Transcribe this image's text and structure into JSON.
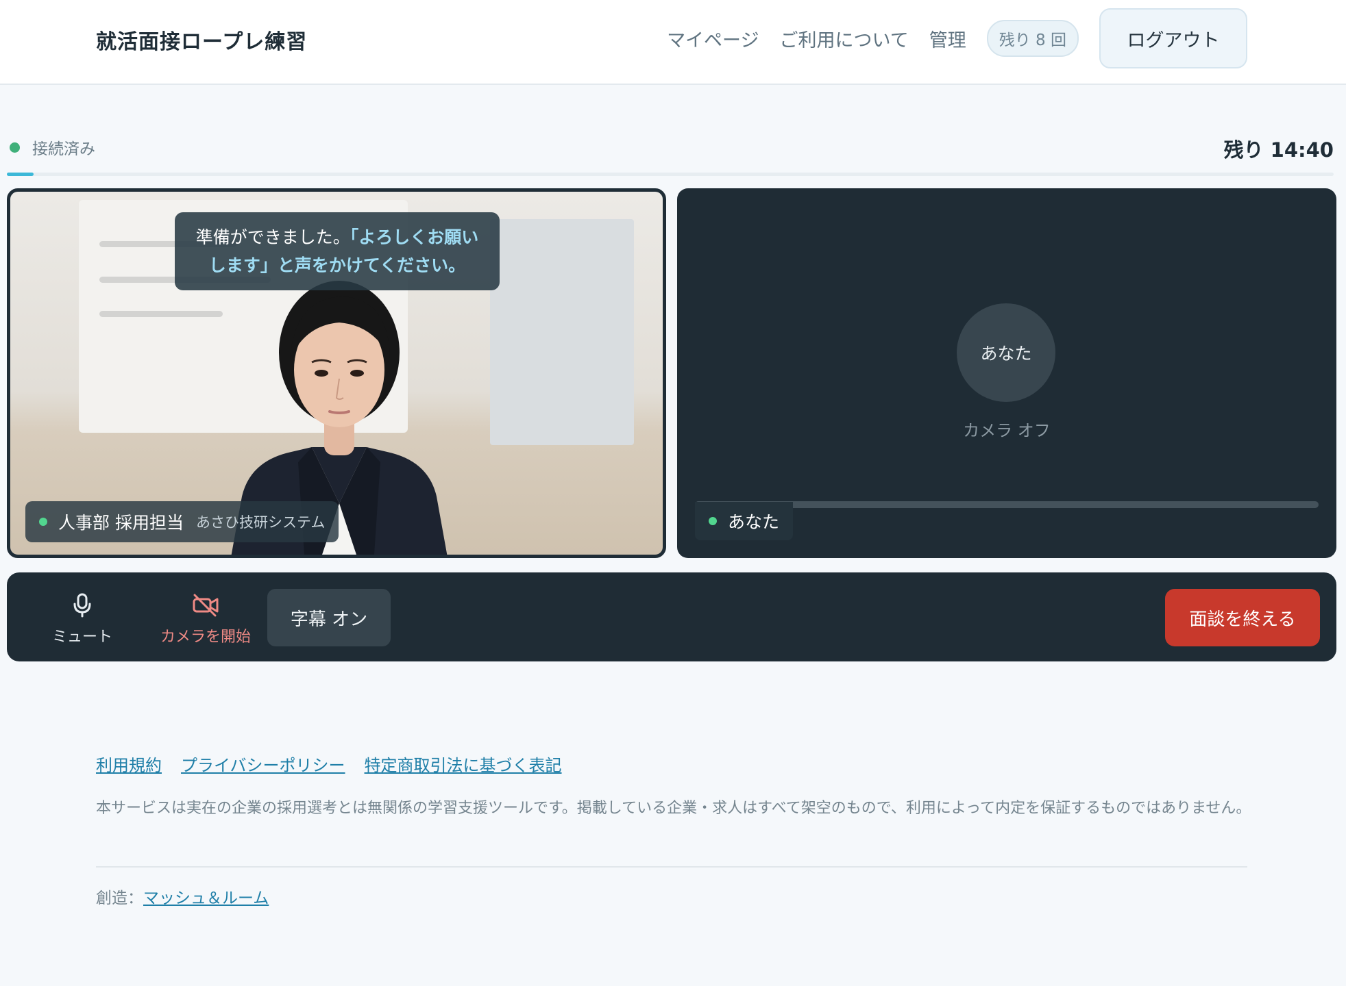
{
  "header": {
    "brand": "就活面接ロープレ練習",
    "nav": {
      "mypage": "マイページ",
      "about": "ご利用について",
      "admin": "管理"
    },
    "remaining_badge": "残り 8 回",
    "logout_label": "ログアウト"
  },
  "session": {
    "status": "接続済み",
    "status_color": "#3fb07a",
    "timer": "残り 14:40",
    "progress_fraction": 0.02
  },
  "interviewer": {
    "subtitle_plain": "準備ができました。",
    "subtitle_highlight": "「よろしくお願いします」と声をかけてください。",
    "name": "人事部 採用担当",
    "company": "あさひ技研システム"
  },
  "user": {
    "avatar_label": "あなた",
    "camera_status": "カメラ オフ",
    "name": "あなた",
    "audio_level": 0
  },
  "controls": {
    "mute_label": "ミュート",
    "mute_icon": "microphone-icon",
    "camera_label": "カメラを開始",
    "camera_icon": "camera-off-icon",
    "caption_label": "字幕 オン",
    "end_label": "面談を終える",
    "end_color": "#c8392c"
  },
  "footer": {
    "links": [
      "利用規約",
      "プライバシーポリシー",
      "特定商取引法に基づく表記"
    ],
    "disclaimer": "本サービスは実在の企業の採用選考とは無関係の学習支援ツールです。掲載している企業・求人はすべて架空のもので、利用によって内定を保証するものではありません。",
    "credit_prefix": "創造：",
    "credit_link": "マッシュ＆ルーム"
  }
}
